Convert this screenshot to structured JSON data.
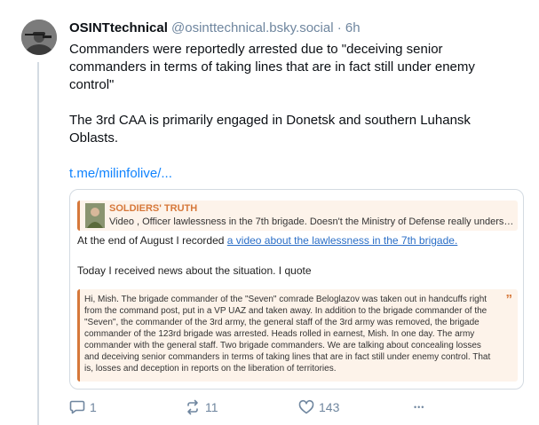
{
  "post": {
    "author": "OSINTtechnical",
    "handle": "@osinttechnical.bsky.social",
    "separator": "·",
    "age": "6h",
    "text_paragraph_1": "Commanders were reportedly arrested due to \"deceiving senior commanders in terms of taking lines that are in fact still under enemy control\"",
    "text_paragraph_2": "The 3rd CAA is primarily engaged in Donetsk and southern Luhansk Oblasts.",
    "link_text": "t.me/milinfolive/..."
  },
  "embed": {
    "reply_title": "SOLDIERS' TRUTH",
    "reply_description": "Video , Officer lawlessness in the 7th brigade. Doesn't the Ministry of Defense really understa...",
    "line1_prefix": "At the end of August I recorded ",
    "line1_link": "a video about the lawlessness in the 7th brigade.",
    "line2": "Today I received news about the situation. I quote",
    "quote_text": "Hi, Mish. The brigade commander of the \"Seven\" comrade Beloglazov was taken out in handcuffs right from the command post, put in a VP UAZ and taken away. In addition to the brigade commander of the \"Seven\", the commander of the 3rd army, the general staff of the 3rd army was removed, the brigade commander of the 123rd brigade was arrested. Heads rolled in earnest, Mish. In one day. The army commander with the general staff. Two brigade commanders. We are talking about concealing losses and deceiving senior commanders in terms of taking lines that are in fact still under enemy control. That is, losses and deception in reports on the liberation of territories.",
    "quote_mark": "”"
  },
  "actions": {
    "replies": "1",
    "reposts": "11",
    "likes": "143",
    "more": "•••"
  },
  "icons": {
    "reply": "speech-bubble-icon",
    "repost": "repost-arrows-icon",
    "like": "heart-icon",
    "more": "ellipsis-icon"
  },
  "colors": {
    "link": "#1083fe",
    "muted": "#6f869f",
    "quote_accent": "#d6783a",
    "quote_bg": "#fdf3ea"
  }
}
